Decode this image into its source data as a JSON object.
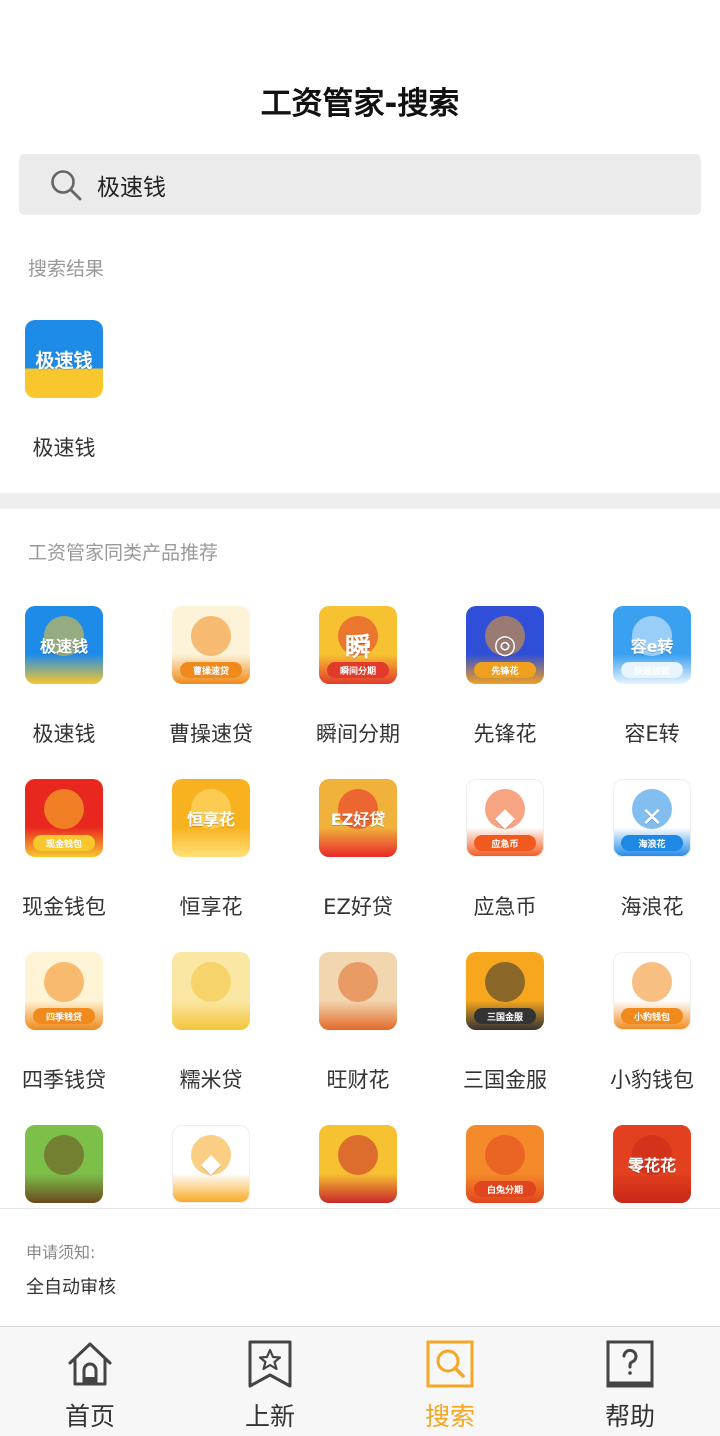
{
  "header": {
    "title": "工资管家-搜索"
  },
  "search": {
    "value": "极速钱"
  },
  "results": {
    "label": "搜索结果",
    "items": [
      {
        "name": "极速钱",
        "icon": "jisuqian-app-icon",
        "icon_text": "极速钱",
        "bg": "#f7c72d"
      }
    ]
  },
  "recommend": {
    "label": "工资管家同类产品推荐",
    "items": [
      {
        "name": "极速钱",
        "icon_text": "极速钱",
        "ribbon": "",
        "bg": "#1e8be8",
        "bg2": "#f7c72d"
      },
      {
        "name": "曹操速贷",
        "icon_text": "",
        "ribbon": "曹操速贷",
        "bg": "#fdf3d8",
        "bg2": "#f08a1c"
      },
      {
        "name": "瞬间分期",
        "icon_text": "瞬",
        "ribbon": "瞬间分期",
        "bg": "#f7c232",
        "bg2": "#e23b2c"
      },
      {
        "name": "先锋花",
        "icon_text": "◎",
        "ribbon": "先锋花",
        "bg": "#2f4fd8",
        "bg2": "#f0a020"
      },
      {
        "name": "容E转",
        "icon_text": "容e转",
        "ribbon": "快速放款",
        "bg": "#3aa0f0",
        "bg2": "#e8f4ff"
      },
      {
        "name": "现金钱包",
        "icon_text": "",
        "ribbon": "现金钱包",
        "bg": "#e8281e",
        "bg2": "#f7c72d"
      },
      {
        "name": "恒享花",
        "icon_text": "恒享花",
        "ribbon": "",
        "bg": "#f9b21f",
        "bg2": "#ffe07a"
      },
      {
        "name": "EZ好贷",
        "icon_text": "EZ好贷",
        "ribbon": "",
        "bg": "#f0b23a",
        "bg2": "#e8282a"
      },
      {
        "name": "应急币",
        "icon_text": "◆",
        "ribbon": "应急币",
        "bg": "#ffffff",
        "bg2": "#f05a1e"
      },
      {
        "name": "海浪花",
        "icon_text": "✕",
        "ribbon": "海浪花",
        "bg": "#ffffff",
        "bg2": "#1e88e5"
      },
      {
        "name": "四季钱贷",
        "icon_text": "",
        "ribbon": "四季钱贷",
        "bg": "#fff4d6",
        "bg2": "#f08a1c"
      },
      {
        "name": "糯米贷",
        "icon_text": "",
        "ribbon": "",
        "bg": "#fbe7a4",
        "bg2": "#f4c53a"
      },
      {
        "name": "旺财花",
        "icon_text": "",
        "ribbon": "",
        "bg": "#f2d6b0",
        "bg2": "#e26b2a"
      },
      {
        "name": "三国金服",
        "icon_text": "",
        "ribbon": "三国金服",
        "bg": "#f7a71e",
        "bg2": "#333333"
      },
      {
        "name": "小豹钱包",
        "icon_text": "",
        "ribbon": "小豹钱包",
        "bg": "#ffffff",
        "bg2": "#f08a1c"
      },
      {
        "name": "",
        "icon_text": "",
        "ribbon": "",
        "bg": "#7cc04a",
        "bg2": "#6b4a1e"
      },
      {
        "name": "",
        "icon_text": "◆",
        "ribbon": "",
        "bg": "#ffffff",
        "bg2": "#f7a71e"
      },
      {
        "name": "",
        "icon_text": "",
        "ribbon": "",
        "bg": "#f7c232",
        "bg2": "#c8282a"
      },
      {
        "name": "",
        "icon_text": "",
        "ribbon": "白兔分期",
        "bg": "#f58a2a",
        "bg2": "#e0461e"
      },
      {
        "name": "",
        "icon_text": "零花花",
        "ribbon": "",
        "bg": "#e2401e",
        "bg2": "#c8281a"
      }
    ]
  },
  "notice": {
    "title": "申请须知:",
    "text": "全自动审核"
  },
  "tabbar": {
    "items": [
      {
        "label": "首页",
        "icon": "home-icon",
        "active": false
      },
      {
        "label": "上新",
        "icon": "new-bookmark-icon",
        "active": false
      },
      {
        "label": "搜索",
        "icon": "search-tab-icon",
        "active": true
      },
      {
        "label": "帮助",
        "icon": "help-icon",
        "active": false
      }
    ]
  },
  "colors": {
    "accent": "#f5a623",
    "text": "#333333",
    "muted": "#999999"
  }
}
